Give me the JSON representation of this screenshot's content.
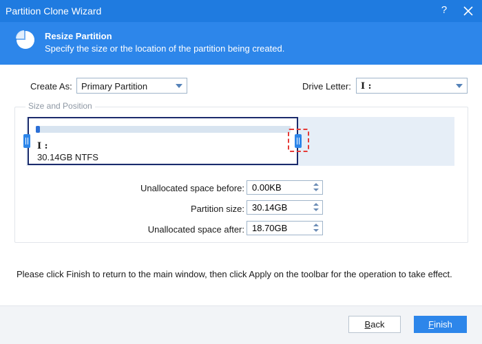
{
  "window": {
    "title": "Partition Clone Wizard",
    "help_glyph": "?"
  },
  "header": {
    "icon": "pie-chart-icon",
    "title": "Resize Partition",
    "subtitle": "Specify the size or the location of the partition being created."
  },
  "create_as": {
    "label": "Create As:",
    "value": "Primary Partition"
  },
  "drive_letter": {
    "label": "Drive Letter:",
    "value": "I :"
  },
  "size_position": {
    "group_label": "Size and Position",
    "partition": {
      "letter": "I :",
      "info": "30.14GB NTFS",
      "used_fraction": 0.02,
      "disk_fraction": 0.63
    }
  },
  "fields": {
    "before": {
      "label": "Unallocated space before:",
      "value": "0.00KB"
    },
    "size": {
      "label": "Partition size:",
      "value": "30.14GB"
    },
    "after": {
      "label": "Unallocated space after:",
      "value": "18.70GB"
    }
  },
  "instruction": "Please click Finish to return to the main window, then click Apply on the toolbar for the operation to take effect.",
  "buttons": {
    "back": {
      "mnemonic": "B",
      "rest": "ack"
    },
    "finish": {
      "mnemonic": "F",
      "rest": "inish"
    }
  },
  "colors": {
    "accent": "#2d86ea",
    "titlebar": "#1f7be0",
    "partition_border": "#1a2a6b",
    "highlight": "#e53935"
  }
}
